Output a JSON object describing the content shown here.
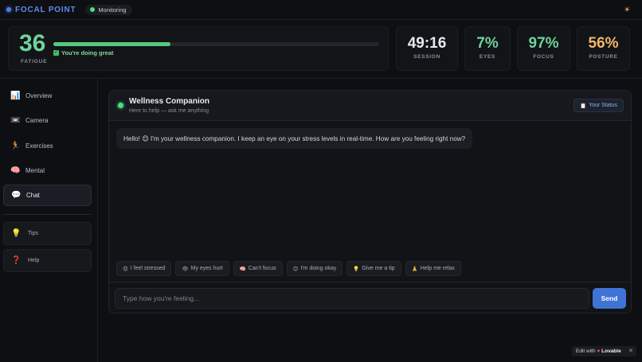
{
  "app": {
    "name": "FOCAL POINT",
    "monitor_label": "Monitoring"
  },
  "stats": {
    "fatigue": {
      "value": "36",
      "label": "FATIGUE",
      "progress_percent": 36,
      "status": "You're doing great"
    },
    "metrics": [
      {
        "value": "49:16",
        "label": "SESSION",
        "color": "#e6e9ee"
      },
      {
        "value": "7%",
        "label": "EYES",
        "color": "#6ed39a"
      },
      {
        "value": "97%",
        "label": "FOCUS",
        "color": "#6ed39a"
      },
      {
        "value": "56%",
        "label": "POSTURE",
        "color": "#f2b86a"
      }
    ]
  },
  "sidebar": {
    "items": [
      {
        "label": "Overview",
        "icon": "bar-chart-icon"
      },
      {
        "label": "Camera",
        "icon": "camera-icon"
      },
      {
        "label": "Exercises",
        "icon": "runner-icon"
      },
      {
        "label": "Mental",
        "icon": "brain-icon"
      },
      {
        "label": "Chat",
        "icon": "speech-bubble-icon",
        "active": true
      }
    ],
    "extras": [
      {
        "label": "Tips",
        "icon": "lightbulb-icon"
      },
      {
        "label": "Help",
        "icon": "question-icon"
      }
    ]
  },
  "chat": {
    "title": "Wellness Companion",
    "subtitle": "Here to help — ask me anything",
    "status_button": "Your Status",
    "message": "Hello! 😊 I'm your wellness companion. I keep an eye on your stress levels in real-time. How are you feeling right now?",
    "quick_replies": [
      {
        "icon": "😟",
        "label": "I feel stressed"
      },
      {
        "icon": "👁",
        "label": "My eyes hurt"
      },
      {
        "icon": "🧠",
        "label": "Can't focus"
      },
      {
        "icon": "😊",
        "label": "I'm doing okay"
      },
      {
        "icon": "💡",
        "label": "Give me a tip"
      },
      {
        "icon": "🙏",
        "label": "Help me relax"
      }
    ],
    "input_placeholder": "Type how you're feeling...",
    "send_label": "Send"
  },
  "badge": {
    "edit_text": "Edit with",
    "brand": "Lovable",
    "close": "✕"
  }
}
